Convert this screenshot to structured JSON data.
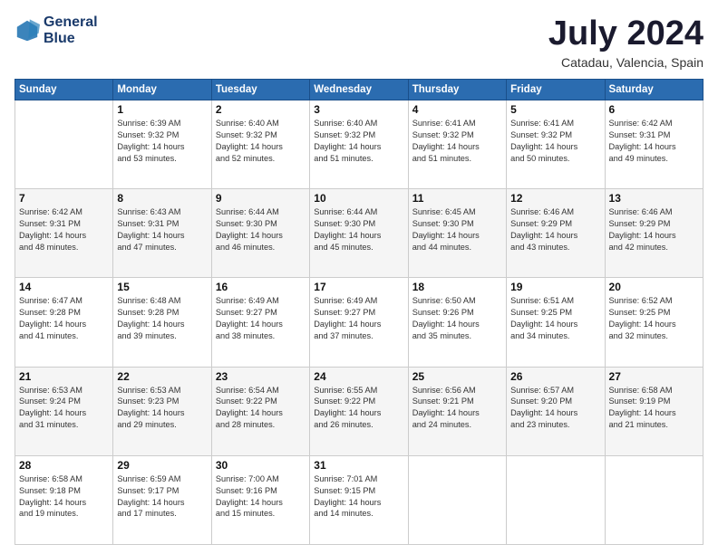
{
  "logo": {
    "line1": "General",
    "line2": "Blue"
  },
  "title": "July 2024",
  "subtitle": "Catadau, Valencia, Spain",
  "headers": [
    "Sunday",
    "Monday",
    "Tuesday",
    "Wednesday",
    "Thursday",
    "Friday",
    "Saturday"
  ],
  "weeks": [
    [
      {
        "day": "",
        "info": ""
      },
      {
        "day": "1",
        "info": "Sunrise: 6:39 AM\nSunset: 9:32 PM\nDaylight: 14 hours\nand 53 minutes."
      },
      {
        "day": "2",
        "info": "Sunrise: 6:40 AM\nSunset: 9:32 PM\nDaylight: 14 hours\nand 52 minutes."
      },
      {
        "day": "3",
        "info": "Sunrise: 6:40 AM\nSunset: 9:32 PM\nDaylight: 14 hours\nand 51 minutes."
      },
      {
        "day": "4",
        "info": "Sunrise: 6:41 AM\nSunset: 9:32 PM\nDaylight: 14 hours\nand 51 minutes."
      },
      {
        "day": "5",
        "info": "Sunrise: 6:41 AM\nSunset: 9:32 PM\nDaylight: 14 hours\nand 50 minutes."
      },
      {
        "day": "6",
        "info": "Sunrise: 6:42 AM\nSunset: 9:31 PM\nDaylight: 14 hours\nand 49 minutes."
      }
    ],
    [
      {
        "day": "7",
        "info": "Sunrise: 6:42 AM\nSunset: 9:31 PM\nDaylight: 14 hours\nand 48 minutes."
      },
      {
        "day": "8",
        "info": "Sunrise: 6:43 AM\nSunset: 9:31 PM\nDaylight: 14 hours\nand 47 minutes."
      },
      {
        "day": "9",
        "info": "Sunrise: 6:44 AM\nSunset: 9:30 PM\nDaylight: 14 hours\nand 46 minutes."
      },
      {
        "day": "10",
        "info": "Sunrise: 6:44 AM\nSunset: 9:30 PM\nDaylight: 14 hours\nand 45 minutes."
      },
      {
        "day": "11",
        "info": "Sunrise: 6:45 AM\nSunset: 9:30 PM\nDaylight: 14 hours\nand 44 minutes."
      },
      {
        "day": "12",
        "info": "Sunrise: 6:46 AM\nSunset: 9:29 PM\nDaylight: 14 hours\nand 43 minutes."
      },
      {
        "day": "13",
        "info": "Sunrise: 6:46 AM\nSunset: 9:29 PM\nDaylight: 14 hours\nand 42 minutes."
      }
    ],
    [
      {
        "day": "14",
        "info": "Sunrise: 6:47 AM\nSunset: 9:28 PM\nDaylight: 14 hours\nand 41 minutes."
      },
      {
        "day": "15",
        "info": "Sunrise: 6:48 AM\nSunset: 9:28 PM\nDaylight: 14 hours\nand 39 minutes."
      },
      {
        "day": "16",
        "info": "Sunrise: 6:49 AM\nSunset: 9:27 PM\nDaylight: 14 hours\nand 38 minutes."
      },
      {
        "day": "17",
        "info": "Sunrise: 6:49 AM\nSunset: 9:27 PM\nDaylight: 14 hours\nand 37 minutes."
      },
      {
        "day": "18",
        "info": "Sunrise: 6:50 AM\nSunset: 9:26 PM\nDaylight: 14 hours\nand 35 minutes."
      },
      {
        "day": "19",
        "info": "Sunrise: 6:51 AM\nSunset: 9:25 PM\nDaylight: 14 hours\nand 34 minutes."
      },
      {
        "day": "20",
        "info": "Sunrise: 6:52 AM\nSunset: 9:25 PM\nDaylight: 14 hours\nand 32 minutes."
      }
    ],
    [
      {
        "day": "21",
        "info": "Sunrise: 6:53 AM\nSunset: 9:24 PM\nDaylight: 14 hours\nand 31 minutes."
      },
      {
        "day": "22",
        "info": "Sunrise: 6:53 AM\nSunset: 9:23 PM\nDaylight: 14 hours\nand 29 minutes."
      },
      {
        "day": "23",
        "info": "Sunrise: 6:54 AM\nSunset: 9:22 PM\nDaylight: 14 hours\nand 28 minutes."
      },
      {
        "day": "24",
        "info": "Sunrise: 6:55 AM\nSunset: 9:22 PM\nDaylight: 14 hours\nand 26 minutes."
      },
      {
        "day": "25",
        "info": "Sunrise: 6:56 AM\nSunset: 9:21 PM\nDaylight: 14 hours\nand 24 minutes."
      },
      {
        "day": "26",
        "info": "Sunrise: 6:57 AM\nSunset: 9:20 PM\nDaylight: 14 hours\nand 23 minutes."
      },
      {
        "day": "27",
        "info": "Sunrise: 6:58 AM\nSunset: 9:19 PM\nDaylight: 14 hours\nand 21 minutes."
      }
    ],
    [
      {
        "day": "28",
        "info": "Sunrise: 6:58 AM\nSunset: 9:18 PM\nDaylight: 14 hours\nand 19 minutes."
      },
      {
        "day": "29",
        "info": "Sunrise: 6:59 AM\nSunset: 9:17 PM\nDaylight: 14 hours\nand 17 minutes."
      },
      {
        "day": "30",
        "info": "Sunrise: 7:00 AM\nSunset: 9:16 PM\nDaylight: 14 hours\nand 15 minutes."
      },
      {
        "day": "31",
        "info": "Sunrise: 7:01 AM\nSunset: 9:15 PM\nDaylight: 14 hours\nand 14 minutes."
      },
      {
        "day": "",
        "info": ""
      },
      {
        "day": "",
        "info": ""
      },
      {
        "day": "",
        "info": ""
      }
    ]
  ]
}
